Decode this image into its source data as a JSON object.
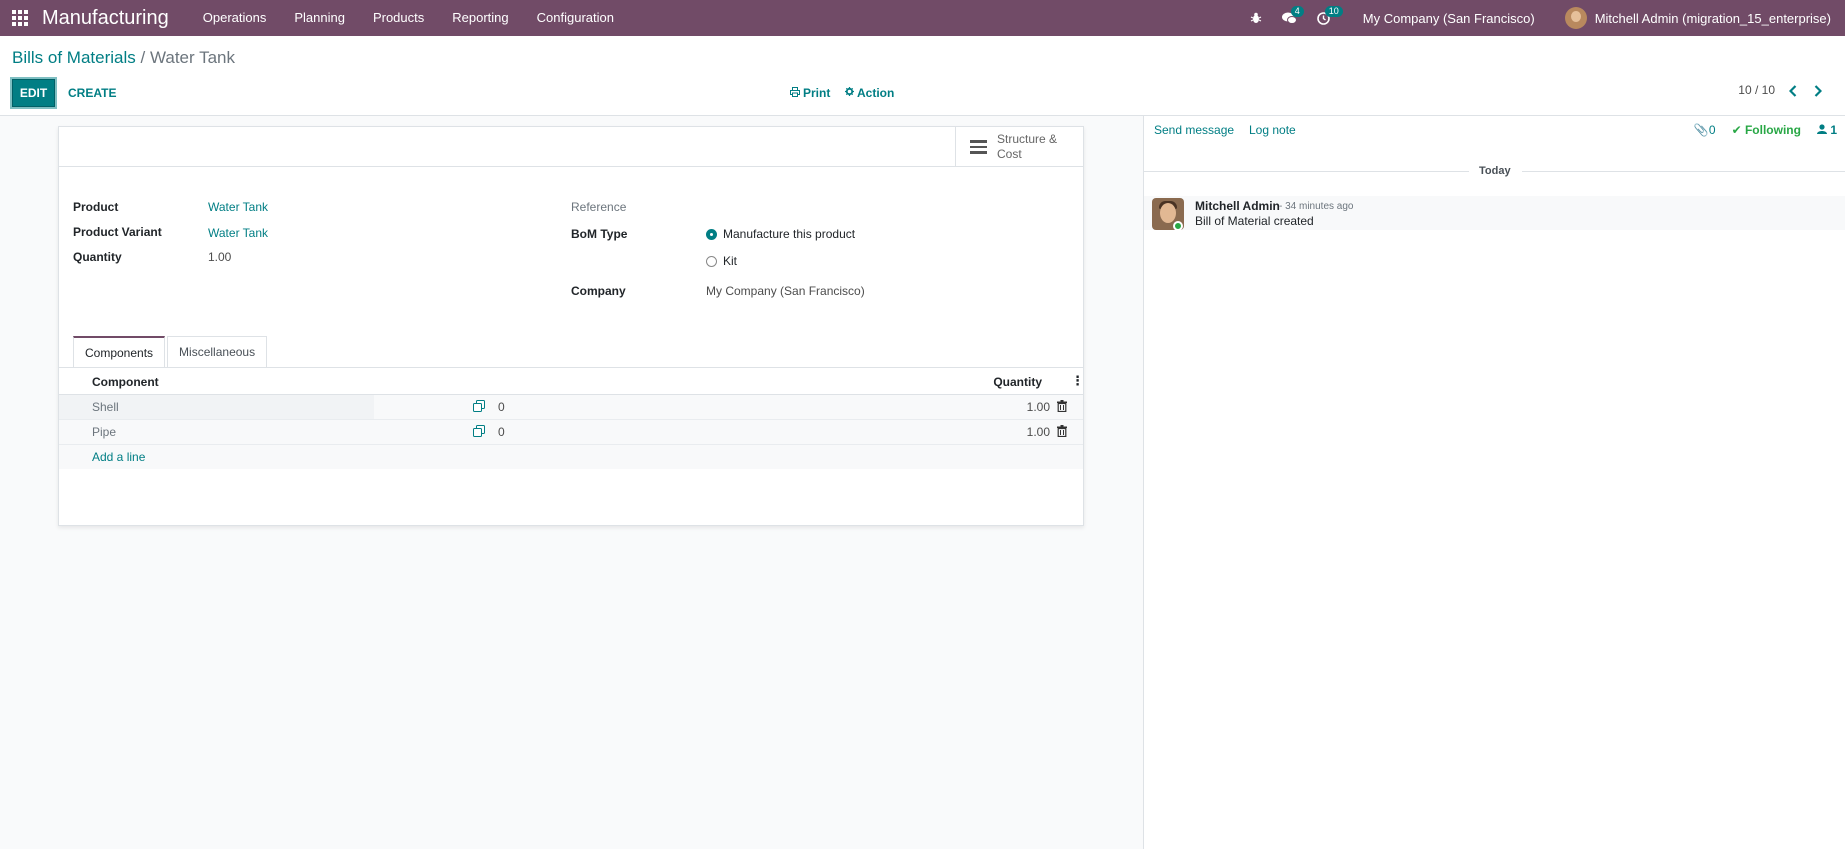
{
  "navbar": {
    "app_name": "Manufacturing",
    "menu": [
      "Operations",
      "Planning",
      "Products",
      "Reporting",
      "Configuration"
    ],
    "messages_count": "4",
    "activities_count": "10",
    "company": "My Company (San Francisco)",
    "user": "Mitchell Admin (migration_15_enterprise)"
  },
  "breadcrumb": {
    "parent": "Bills of Materials",
    "separator": "/",
    "current": "Water Tank"
  },
  "toolbar": {
    "edit_label": "EDIT",
    "create_label": "CREATE",
    "print_label": "Print",
    "action_label": "Action"
  },
  "pager": {
    "value": "10 / 10"
  },
  "smart_button": {
    "label": "Structure & Cost"
  },
  "form": {
    "product_label": "Product",
    "product_value": "Water Tank",
    "variant_label": "Product Variant",
    "variant_value": "Water Tank",
    "quantity_label": "Quantity",
    "quantity_value": "1.00",
    "reference_label": "Reference",
    "bom_type_label": "BoM Type",
    "bom_type_options": [
      "Manufacture this product",
      "Kit"
    ],
    "bom_type_selected": "Manufacture this product",
    "company_label": "Company",
    "company_value": "My Company (San Francisco)"
  },
  "tabs": [
    "Components",
    "Miscellaneous"
  ],
  "components_table": {
    "headers": {
      "component": "Component",
      "quantity": "Quantity"
    },
    "rows": [
      {
        "component": "Shell",
        "available": "0",
        "quantity": "1.00"
      },
      {
        "component": "Pipe",
        "available": "0",
        "quantity": "1.00"
      }
    ],
    "add_line": "Add a line"
  },
  "chatter": {
    "send_message": "Send message",
    "log_note": "Log note",
    "attachments": "0",
    "following": "Following",
    "followers": "1",
    "date_separator": "Today",
    "message": {
      "author": "Mitchell Admin",
      "time": "- 34 minutes ago",
      "body": "Bill of Material created"
    }
  },
  "colors": {
    "navbar": "#714b67",
    "accent": "#017e84",
    "following": "#28a745"
  }
}
